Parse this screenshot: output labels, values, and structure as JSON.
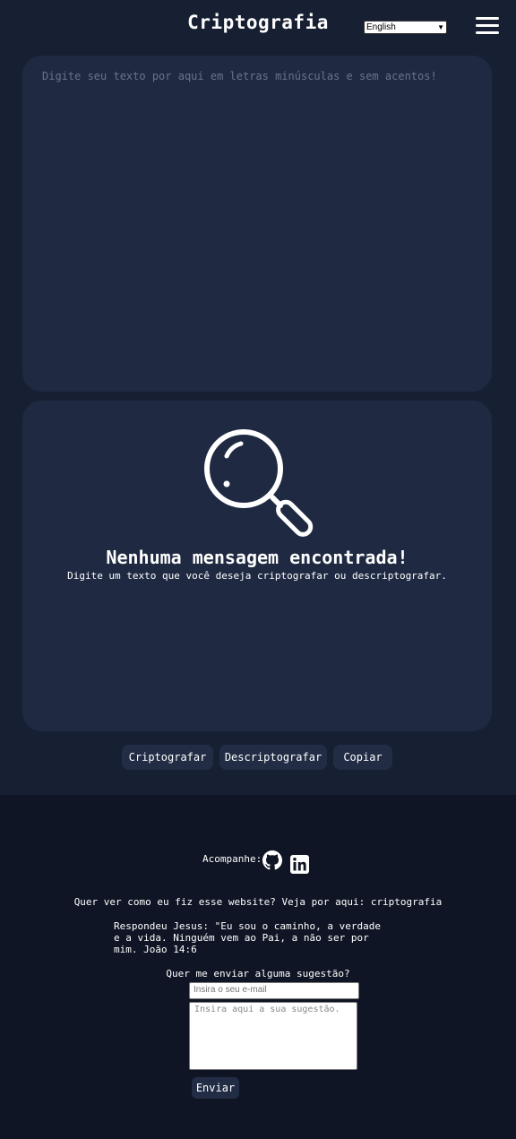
{
  "header": {
    "title": "Criptografia",
    "language_selected": "English"
  },
  "input": {
    "placeholder": "Digite seu texto por aqui em letras minúsculas e sem acentos!"
  },
  "output": {
    "empty_title": "Nenhuma mensagem encontrada!",
    "empty_subtitle": "Digite um texto que você deseja criptografar ou descriptografar.",
    "icon": "magnifier-icon"
  },
  "actions": {
    "encrypt_label": "Criptografar",
    "decrypt_label": "Descriptografar",
    "copy_label": "Copiar"
  },
  "footer": {
    "follow_label": "Acompanhe:",
    "social_icons": [
      "github-icon",
      "linkedin-icon"
    ],
    "site_line": "Quer ver como eu fiz esse website? Veja por aqui: criptografia",
    "verse": "Respondeu Jesus: \"Eu sou o caminho, a verdade e a vida. Ninguém vem ao Pai, a não ser por mim. João 14:6",
    "suggest_label": "Quer me enviar alguma sugestão?",
    "email_placeholder": "Insira o seu e-mail",
    "suggestion_placeholder": "Insira aqui a sua sugestão.",
    "send_label": "Enviar"
  },
  "colors": {
    "background": "#172033",
    "card": "#1f2a42",
    "button": "#222d45",
    "footer": "#0f1525",
    "text": "#ffffff"
  }
}
